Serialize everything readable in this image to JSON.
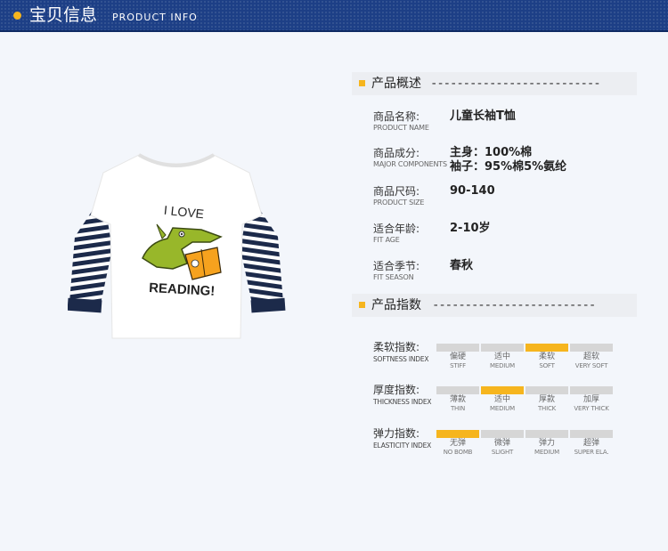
{
  "header": {
    "title_cn": "宝贝信息",
    "title_en": "PRODUCT INFO"
  },
  "product_image": {
    "shirt_text_top": "I LOVE",
    "shirt_text_bottom": "READING!"
  },
  "overview": {
    "title": "产品概述",
    "dashes": "--------------------------",
    "rows": [
      {
        "label_cn": "商品名称:",
        "label_en": "PRODUCT NAME",
        "value": "儿童长袖T恤",
        "value2": ""
      },
      {
        "label_cn": "商品成分:",
        "label_en": "MAJOR COMPONENTS",
        "value": "主身：100%棉",
        "value2": "袖子：95%棉5%氨纶"
      },
      {
        "label_cn": "商品尺码:",
        "label_en": "PRODUCT SIZE",
        "value": "90-140",
        "value2": ""
      },
      {
        "label_cn": "适合年龄:",
        "label_en": "FIT AGE",
        "value": "2-10岁",
        "value2": ""
      },
      {
        "label_cn": "适合季节:",
        "label_en": "FIT SEASON",
        "value": "春秋",
        "value2": ""
      }
    ]
  },
  "index": {
    "title": "产品指数",
    "dashes": "-------------------------",
    "rows": [
      {
        "label_cn": "柔软指数:",
        "label_en": "SOFTNESS INDEX",
        "selected": 2,
        "options": [
          {
            "cn": "偏硬",
            "en": "STIFF"
          },
          {
            "cn": "适中",
            "en": "MEDIUM"
          },
          {
            "cn": "柔软",
            "en": "SOFT"
          },
          {
            "cn": "超软",
            "en": "VERY SOFT"
          }
        ]
      },
      {
        "label_cn": "厚度指数:",
        "label_en": "THICKNESS INDEX",
        "selected": 1,
        "options": [
          {
            "cn": "薄款",
            "en": "THIN"
          },
          {
            "cn": "适中",
            "en": "MEDIUM"
          },
          {
            "cn": "厚款",
            "en": "THICK"
          },
          {
            "cn": "加厚",
            "en": "VERY THICK"
          }
        ]
      },
      {
        "label_cn": "弹力指数:",
        "label_en": "ELASTICITY INDEX",
        "selected": 0,
        "options": [
          {
            "cn": "无弹",
            "en": "NO BOMB"
          },
          {
            "cn": "微弹",
            "en": "SLIGHT"
          },
          {
            "cn": "弹力",
            "en": "MEDIUM"
          },
          {
            "cn": "超弹",
            "en": "SUPER ELA."
          }
        ]
      }
    ]
  },
  "colors": {
    "header_bg": "#1d3f86",
    "accent": "#f6b51e",
    "stripe": "#1c2a4a",
    "dino": "#98b72a"
  }
}
